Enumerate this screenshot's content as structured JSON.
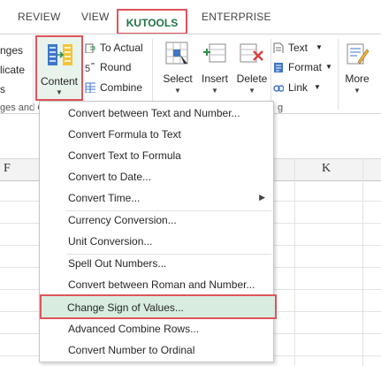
{
  "tabs": {
    "review": "REVIEW",
    "view": "VIEW",
    "kutools": "KUTOOLS",
    "enterprise": "ENTERPRISE"
  },
  "ribbon": {
    "left_partial": [
      "nges",
      "licate",
      "s"
    ],
    "left_group_label": "ges and C",
    "content_label": "Content",
    "to_actual": "To Actual",
    "round": "Round",
    "combine": "Combine",
    "select": "Select",
    "insert": "Insert",
    "delete": "Delete",
    "text": "Text",
    "format": "Format",
    "link": "Link",
    "more": "More",
    "editing_group_label_partial": "g"
  },
  "sheet": {
    "col_f": "F",
    "col_k": "K"
  },
  "menu": {
    "items": [
      "Convert between Text and Number...",
      "Convert Formula to Text",
      "Convert Text to Formula",
      "Convert to Date...",
      "Convert Time...",
      "Currency Conversion...",
      "Unit Conversion...",
      "Spell Out Numbers...",
      "Convert between Roman and Number...",
      "Change Sign of Values...",
      "Advanced Combine Rows...",
      "Convert Number to Ordinal"
    ]
  },
  "colors": {
    "accent_green": "#217346",
    "highlight_red": "#e0545b",
    "hover_green": "#d8ede0"
  }
}
